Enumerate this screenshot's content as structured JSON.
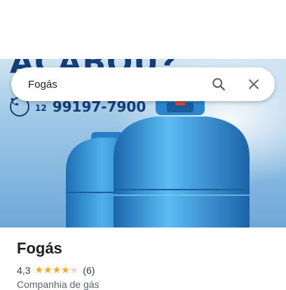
{
  "hero": {
    "promo_text": "ACABOU?",
    "phone_area": "12",
    "phone_number": "99197-7900"
  },
  "search": {
    "value": "Fogás",
    "search_icon": "search-icon",
    "clear_icon": "close-icon"
  },
  "place": {
    "name": "Fogás",
    "rating": "4,3",
    "stars": 4.3,
    "reviews": "(6)",
    "category": "Companhia de gás"
  },
  "colors": {
    "brand_blue": "#143e78",
    "star": "#f5a623",
    "cylinder": "#2d8fd6"
  }
}
